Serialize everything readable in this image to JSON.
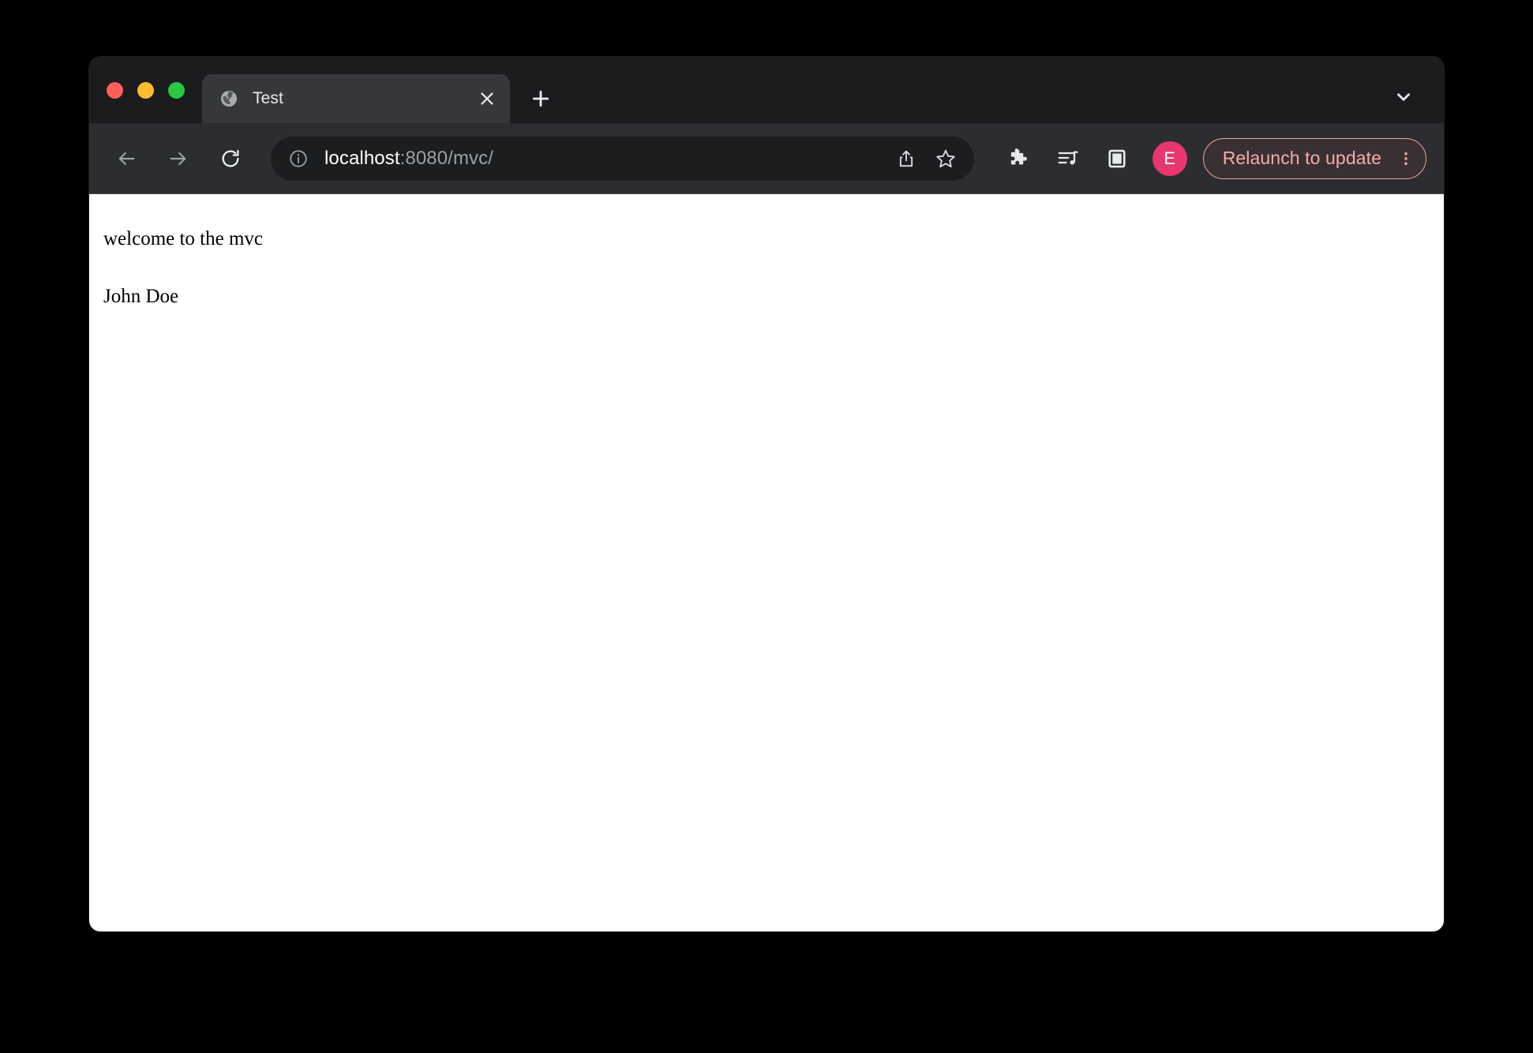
{
  "window": {
    "traffic_lights": [
      {
        "name": "close",
        "color": "#ff5f57"
      },
      {
        "name": "minimize",
        "color": "#ffbd2e"
      },
      {
        "name": "maximize",
        "color": "#28c840"
      }
    ]
  },
  "tab_strip": {
    "tabs": [
      {
        "title": "Test",
        "favicon": "globe-icon",
        "active": true,
        "close_label": "×"
      }
    ],
    "new_tab_label": "+",
    "tab_search_icon": "chevron-down-icon"
  },
  "toolbar": {
    "back_icon": "arrow-left-icon",
    "forward_icon": "arrow-right-icon",
    "reload_icon": "reload-icon",
    "omnibox": {
      "info_icon": "info-circle-icon",
      "url_host": "localhost",
      "url_rest": ":8080/mvc/",
      "url_full": "localhost:8080/mvc/",
      "share_icon": "share-icon",
      "bookmark_icon": "star-outline-icon"
    },
    "extensions_icon": "puzzle-piece-icon",
    "media_icon": "media-control-icon",
    "side_panel_icon": "side-panel-icon",
    "profile": {
      "initial": "E",
      "background": "#e8366e"
    },
    "update": {
      "label": "Relaunch to update",
      "text_color": "#f3ada5",
      "border_color": "#eda69d",
      "background": "#3a3033",
      "menu_icon": "three-dots-vertical-icon"
    }
  },
  "page": {
    "lines": [
      "welcome to the mvc",
      "John Doe"
    ]
  }
}
